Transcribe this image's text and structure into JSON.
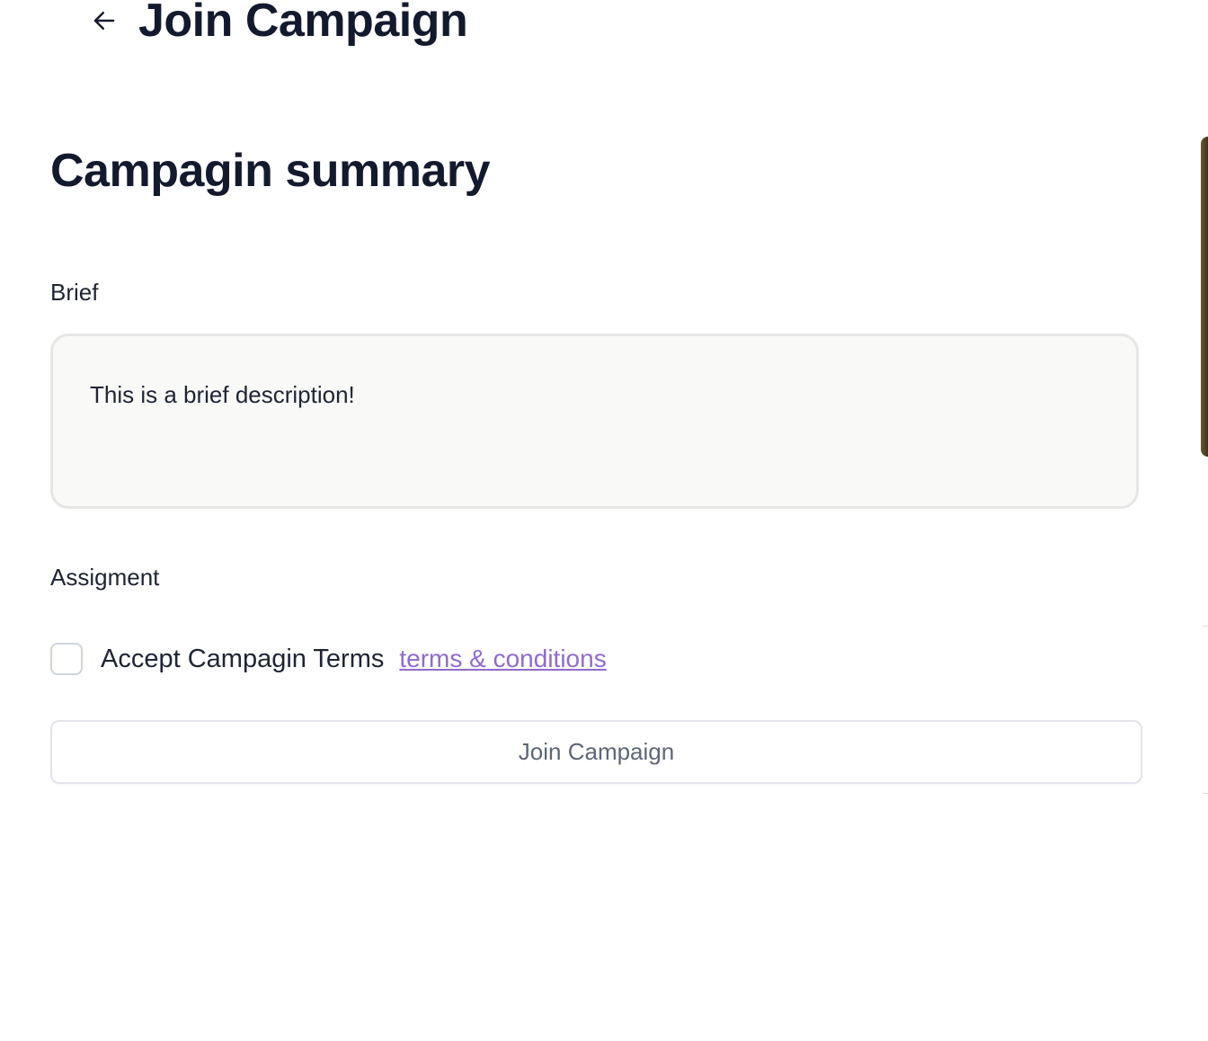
{
  "header": {
    "back_icon": "arrow-left-icon",
    "title": "Join Campaign"
  },
  "summary": {
    "title": "Campagin summary",
    "brief_label": "Brief",
    "brief_text": "This is a brief description!",
    "assignment_label": "Assigment"
  },
  "terms": {
    "checked": false,
    "label": "Accept Campagin Terms",
    "link_text": "terms & conditions",
    "link_color": "#8f6bd0"
  },
  "actions": {
    "join_label": "Join Campaign"
  },
  "colors": {
    "text_primary": "#141a2e",
    "brief_background": "#f9f9f8",
    "button_text": "#5d6678"
  }
}
